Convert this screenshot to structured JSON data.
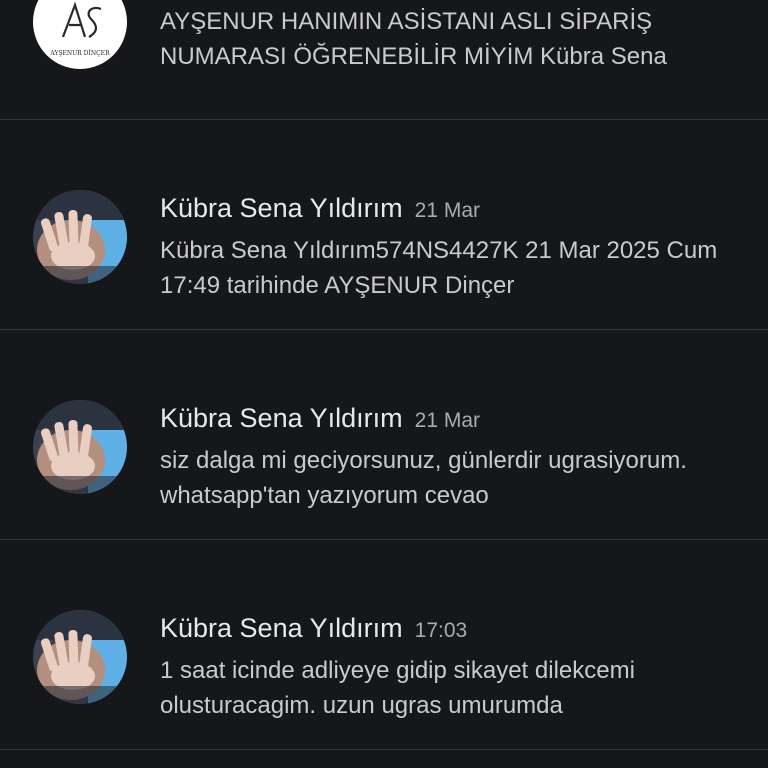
{
  "messages": [
    {
      "sender": "",
      "time": "",
      "preview": "AYŞENUR HANIMIN ASİSTANI ASLI SİPARİŞ NUMARASI ÖĞRENEBİLİR MİYİM Kübra Sena",
      "avatar": {
        "type": "logo",
        "text": "AYŞENUR DİNÇER"
      }
    },
    {
      "sender": "Kübra Sena Yıldırım",
      "time": "21 Mar",
      "preview": "Kübra Sena Yıldırım574NS4427K 21 Mar 2025 Cum 17:49 tarihinde AYŞENUR Dinçer",
      "avatar": {
        "type": "photo",
        "icon": "hand-photo"
      }
    },
    {
      "sender": "Kübra Sena Yıldırım",
      "time": "21 Mar",
      "preview": "siz dalga mi geciyorsunuz, günlerdir ugrasiyorum. whatsapp'tan yazıyorum cevao",
      "avatar": {
        "type": "photo",
        "icon": "hand-photo"
      }
    },
    {
      "sender": "Kübra Sena Yıldırım",
      "time": "17:03",
      "preview": "1 saat icinde adliyeye gidip sikayet dilekcemi olusturacagim. uzun ugras umurumda",
      "avatar": {
        "type": "photo",
        "icon": "hand-photo"
      }
    }
  ],
  "colors": {
    "background": "#16171b",
    "divider": "#34363c",
    "sender": "#e8e9ec",
    "time": "#a9abb1",
    "preview": "#c9cacf"
  }
}
